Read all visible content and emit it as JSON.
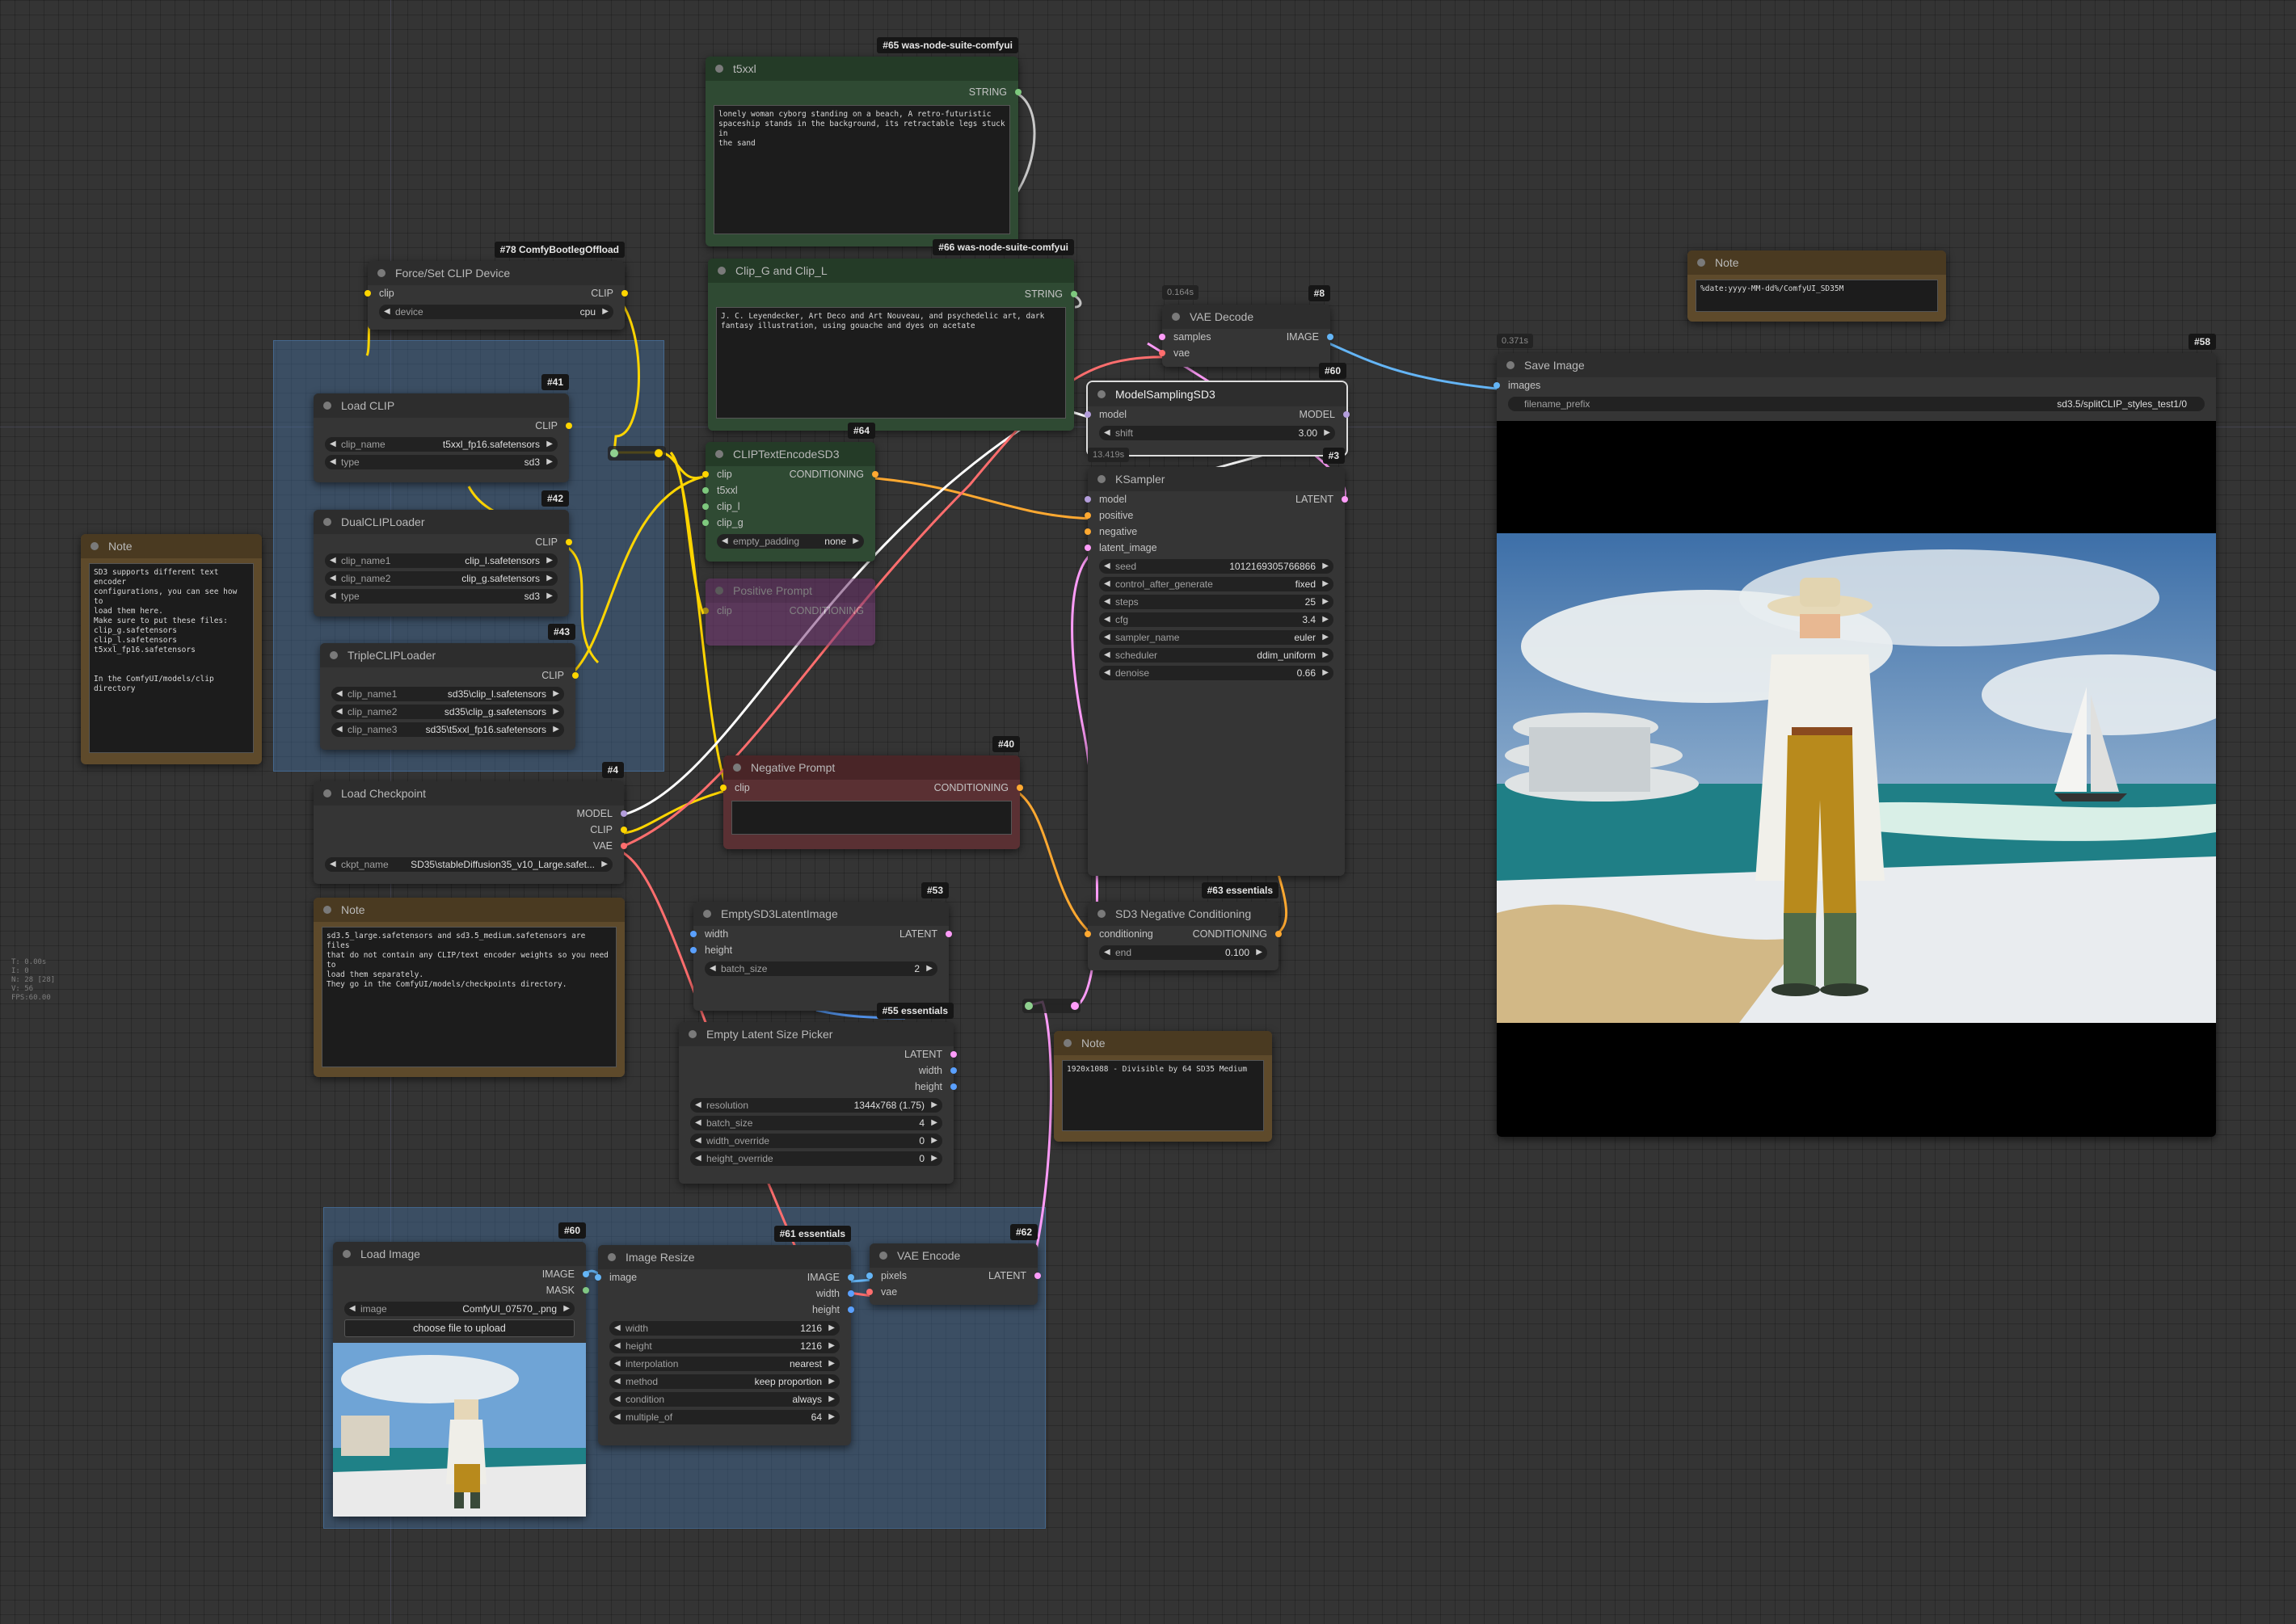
{
  "colors": {
    "clip": "#ffd500",
    "model": "#b39ddb",
    "vae": "#ff6e6e",
    "conditioning": "#ffa931",
    "latent": "#ff9cf9",
    "image": "#64b5f6",
    "string": "#7ec97e",
    "mask": "#81c784",
    "int": "#7ec97e"
  },
  "groups": [
    {
      "title": ""
    },
    {
      "title": ""
    }
  ],
  "stats": "T: 0.00s\nI: 0\nN: 28 [28]\nV: 56\nFPS:60.00",
  "nodes": {
    "force_clip": {
      "title": "Force/Set CLIP Device",
      "badge": "#78 ComfyBootlegOffload",
      "inputs": [
        "clip"
      ],
      "outputs": [
        "CLIP"
      ],
      "widgets": [
        {
          "name": "device",
          "value": "cpu"
        }
      ]
    },
    "load_clip": {
      "title": "Load CLIP",
      "badge": "#41",
      "outputs": [
        "CLIP"
      ],
      "widgets": [
        {
          "name": "clip_name",
          "value": "t5xxl_fp16.safetensors"
        },
        {
          "name": "type",
          "value": "sd3"
        }
      ]
    },
    "dual_clip": {
      "title": "DualCLIPLoader",
      "badge": "#42",
      "outputs": [
        "CLIP"
      ],
      "widgets": [
        {
          "name": "clip_name1",
          "value": "clip_l.safetensors"
        },
        {
          "name": "clip_name2",
          "value": "clip_g.safetensors"
        },
        {
          "name": "type",
          "value": "sd3"
        }
      ]
    },
    "triple_clip": {
      "title": "TripleCLIPLoader",
      "badge": "#43",
      "outputs": [
        "CLIP"
      ],
      "widgets": [
        {
          "name": "clip_name1",
          "value": "sd35\\clip_l.safetensors"
        },
        {
          "name": "clip_name2",
          "value": "sd35\\clip_g.safetensors"
        },
        {
          "name": "clip_name3",
          "value": "sd35\\t5xxl_fp16.safetensors"
        }
      ]
    },
    "note1": {
      "title": "Note",
      "text": "SD3 supports different text encoder\nconfigurations, you can see how to\nload them here.\nMake sure to put these files:\nclip_g.safetensors\nclip_l.safetensors\nt5xxl_fp16.safetensors\n\n\nIn the ComfyUI/models/clip\ndirectory"
    },
    "load_ckpt": {
      "title": "Load Checkpoint",
      "badge": "#4",
      "outputs": [
        "MODEL",
        "CLIP",
        "VAE"
      ],
      "widgets": [
        {
          "name": "ckpt_name",
          "value": "SD35\\stableDiffusion35_v10_Large.safet..."
        }
      ]
    },
    "note2": {
      "title": "Note",
      "text": "sd3.5_large.safetensors and sd3.5_medium.safetensors are files\nthat do not contain any CLIP/text encoder weights so you need to\nload them separately.\nThey go in the ComfyUI/models/checkpoints directory."
    },
    "t5xxl": {
      "title": "t5xxl",
      "badge": "#65 was-node-suite-comfyui",
      "outputs": [
        "STRING"
      ],
      "text": "lonely woman cyborg standing on a beach, A retro-futuristic\nspaceship stands in the background, its retractable legs stuck in\nthe sand"
    },
    "clipg": {
      "title": "Clip_G and Clip_L",
      "badge": "#66 was-node-suite-comfyui",
      "outputs": [
        "STRING"
      ],
      "text": "J. C. Leyendecker, Art Deco and Art Nouveau, and psychedelic art, dark\nfantasy illustration, using gouache and dyes on acetate"
    },
    "clip_encode": {
      "title": "CLIPTextEncodeSD3",
      "badge": "#64",
      "inputs": [
        "clip",
        "t5xxl",
        "clip_l",
        "clip_g"
      ],
      "outputs": [
        "CONDITIONING"
      ],
      "widgets": [
        {
          "name": "empty_padding",
          "value": "none"
        }
      ]
    },
    "pos_prompt": {
      "title": "Positive Prompt",
      "inputs": [
        "clip"
      ],
      "outputs": [
        "CONDITIONING"
      ]
    },
    "neg_prompt": {
      "title": "Negative Prompt",
      "badge": "#40",
      "inputs": [
        "clip"
      ],
      "outputs": [
        "CONDITIONING"
      ],
      "text": ""
    },
    "vae_decode": {
      "title": "VAE Decode",
      "badge": "#8",
      "time": "0.164s",
      "inputs": [
        "samples",
        "vae"
      ],
      "outputs": [
        "IMAGE"
      ]
    },
    "model_sampling": {
      "title": "ModelSamplingSD3",
      "badge": "#60",
      "inputs": [
        "model"
      ],
      "outputs": [
        "MODEL"
      ],
      "widgets": [
        {
          "name": "shift",
          "value": "3.00"
        }
      ]
    },
    "ksampler": {
      "title": "KSampler",
      "badge": "#3",
      "time": "13.419s",
      "inputs": [
        "model",
        "positive",
        "negative",
        "latent_image"
      ],
      "outputs": [
        "LATENT"
      ],
      "widgets": [
        {
          "name": "seed",
          "value": "1012169305766866"
        },
        {
          "name": "control_after_generate",
          "value": "fixed"
        },
        {
          "name": "steps",
          "value": "25"
        },
        {
          "name": "cfg",
          "value": "3.4"
        },
        {
          "name": "sampler_name",
          "value": "euler"
        },
        {
          "name": "scheduler",
          "value": "ddim_uniform"
        },
        {
          "name": "denoise",
          "value": "0.66"
        }
      ]
    },
    "empty_latent": {
      "title": "EmptySD3LatentImage",
      "badge": "#53",
      "inputs": [
        "width",
        "height"
      ],
      "outputs": [
        "LATENT"
      ],
      "widgets": [
        {
          "name": "batch_size",
          "value": "2"
        }
      ]
    },
    "size_picker": {
      "title": "Empty Latent Size Picker",
      "badge": "#55 essentials",
      "outputs": [
        "LATENT",
        "width",
        "height"
      ],
      "widgets": [
        {
          "name": "resolution",
          "value": "1344x768 (1.75)"
        },
        {
          "name": "batch_size",
          "value": "4"
        },
        {
          "name": "width_override",
          "value": "0"
        },
        {
          "name": "height_override",
          "value": "0"
        }
      ]
    },
    "neg_cond": {
      "title": "SD3 Negative Conditioning",
      "badge": "#63 essentials",
      "inputs": [
        "conditioning"
      ],
      "outputs": [
        "CONDITIONING"
      ],
      "widgets": [
        {
          "name": "end",
          "value": "0.100"
        }
      ]
    },
    "note3": {
      "title": "Note",
      "text": "1920x1088 - Divisible by 64 SD35 Medium"
    },
    "note4": {
      "title": "Note",
      "text": "%date:yyyy-MM-dd%/ComfyUI_SD35M"
    },
    "save_image": {
      "title": "Save Image",
      "badge": "#58",
      "time": "0.371s",
      "inputs": [
        "images"
      ],
      "widgets": [
        {
          "name": "filename_prefix",
          "value": "sd3.5/splitCLIP_styles_test1/0"
        }
      ]
    },
    "load_image": {
      "title": "Load Image",
      "badge": "#60",
      "outputs": [
        "IMAGE",
        "MASK"
      ],
      "widgets": [
        {
          "name": "image",
          "value": "ComfyUI_07570_.png"
        }
      ],
      "button": "choose file to upload"
    },
    "image_resize": {
      "title": "Image Resize",
      "badge": "#61 essentials",
      "inputs": [
        "image"
      ],
      "outputs": [
        "IMAGE",
        "width",
        "height"
      ],
      "widgets": [
        {
          "name": "width",
          "value": "1216"
        },
        {
          "name": "height",
          "value": "1216"
        },
        {
          "name": "interpolation",
          "value": "nearest"
        },
        {
          "name": "method",
          "value": "keep proportion"
        },
        {
          "name": "condition",
          "value": "always"
        },
        {
          "name": "multiple_of",
          "value": "64"
        }
      ]
    },
    "vae_encode": {
      "title": "VAE Encode",
      "badge": "#62",
      "inputs": [
        "pixels",
        "vae"
      ],
      "outputs": [
        "LATENT"
      ]
    }
  }
}
